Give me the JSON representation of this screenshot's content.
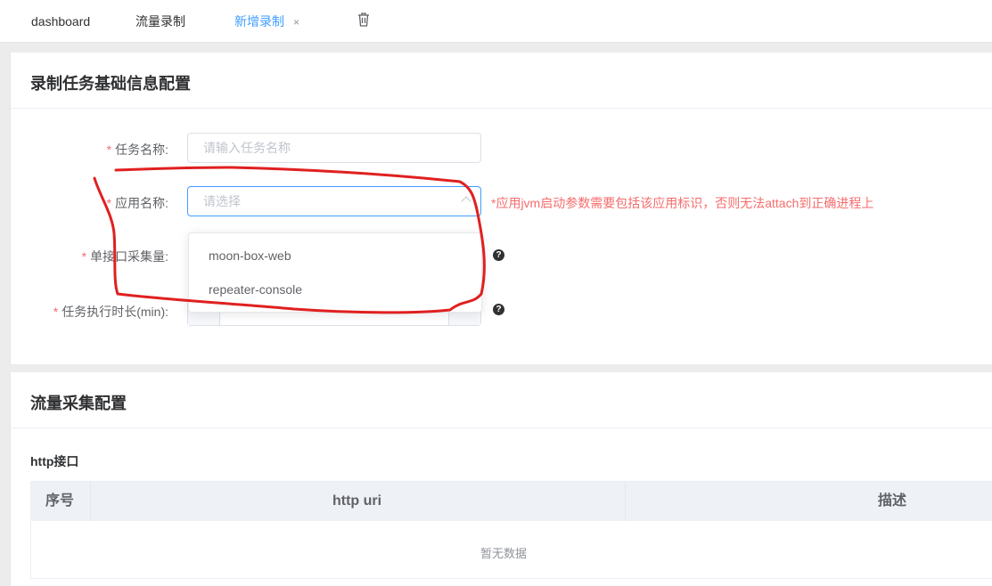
{
  "tabs": [
    {
      "label": "dashboard"
    },
    {
      "label": "流量录制"
    },
    {
      "label": "新增录制",
      "close": "×"
    }
  ],
  "section1": {
    "title": "录制任务基础信息配置",
    "fields": {
      "task_name": {
        "label": "任务名称:",
        "placeholder": "请输入任务名称"
      },
      "app_name": {
        "label": "应用名称:",
        "placeholder": "请选择",
        "hint": "*应用jvm启动参数需要包括该应用标识，否则无法attach到正确进程上"
      },
      "sample_count": {
        "label": "单接口采集量:"
      },
      "duration": {
        "label": "任务执行时长(min):"
      }
    },
    "required_mark": "*",
    "help_glyph": "?",
    "dropdown_options": [
      "moon-box-web",
      "repeater-console"
    ]
  },
  "section2": {
    "title": "流量采集配置",
    "subtitle": "http接口",
    "table": {
      "columns": [
        "序号",
        "http uri",
        "描述"
      ],
      "empty_text": "暂无数据"
    }
  },
  "colors": {
    "accent": "#409eff",
    "required": "#f56c6c",
    "annotation": "#e02020"
  }
}
